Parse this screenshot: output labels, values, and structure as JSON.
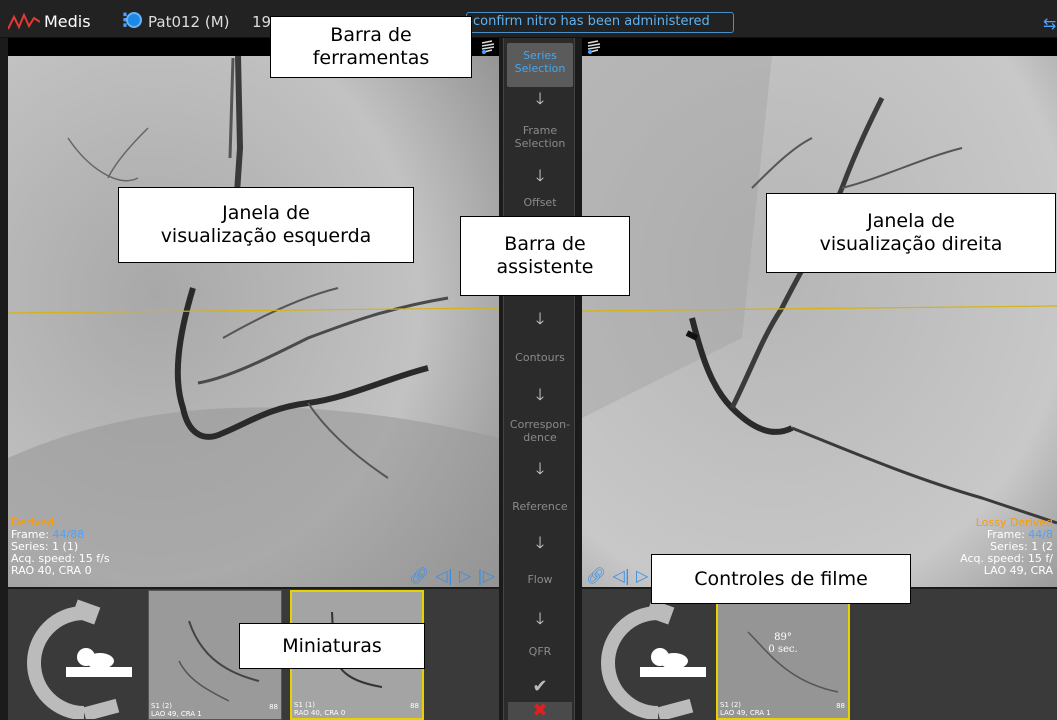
{
  "topbar": {
    "app_name": "Medis",
    "patient": "Pat012 (M)",
    "patient_number_partial": "19",
    "notice": "confirm nitro has been administered"
  },
  "left_viewer": {
    "overlay": {
      "status": "Derived",
      "frame_label": "Frame:",
      "frame_value": "44/88",
      "series": "Series: 1 (1)",
      "acq_speed": "Acq. speed: 15 f/s",
      "angle": "RAO 40, CRA 0"
    }
  },
  "right_viewer": {
    "overlay": {
      "status": "Lossy Derived",
      "frame_label": "Frame:",
      "frame_value": "44/8",
      "series": "Series: 1 (2",
      "acq_speed": "Acq. speed: 15 f/",
      "angle": "LAO 49, CRA"
    }
  },
  "wizard": {
    "steps": [
      {
        "label": "Series Selection",
        "active": true
      },
      {
        "label": "Frame Selection",
        "active": false
      },
      {
        "label": "Offset",
        "active": false
      },
      {
        "label": "Contours",
        "active": false
      },
      {
        "label": "Correspon-dence",
        "active": false
      },
      {
        "label": "Reference",
        "active": false
      },
      {
        "label": "Flow",
        "active": false
      },
      {
        "label": "QFR",
        "active": false
      }
    ],
    "arrow_icon": "arrow-down-icon",
    "confirm_icon": "checkmark-icon",
    "cancel_icon": "cancel-x-icon"
  },
  "thumbnails": {
    "left": [
      {
        "caption_line1": "S1 (2)",
        "caption_line2": "LAO 49, CRA 1",
        "frames": "88",
        "selected": false
      },
      {
        "caption_line1": "S1 (1)",
        "caption_line2": "RAO 40, CRA 0",
        "frames": "88",
        "selected": true
      }
    ],
    "right": [
      {
        "caption_line1": "S1 (2)",
        "caption_line2": "LAO 49, CRA 1",
        "frames": "88",
        "selected": true,
        "center_line1": "89°",
        "center_line2": "0 sec."
      }
    ]
  },
  "callouts": {
    "toolbar": [
      "Barra de",
      "ferramentas"
    ],
    "left_view": [
      "Janela de",
      "visualização esquerda"
    ],
    "wizard": [
      "Barra de",
      "assistente"
    ],
    "right_view": [
      "Janela de",
      "visualização direita"
    ],
    "movie": [
      "Controles de filme"
    ],
    "thumbs": [
      "Miniaturas"
    ]
  },
  "colors": {
    "accent_blue": "#4aa3ff",
    "status_orange": "#ff9a00",
    "selection_yellow": "#e6d200",
    "cancel_red": "#e02020"
  }
}
